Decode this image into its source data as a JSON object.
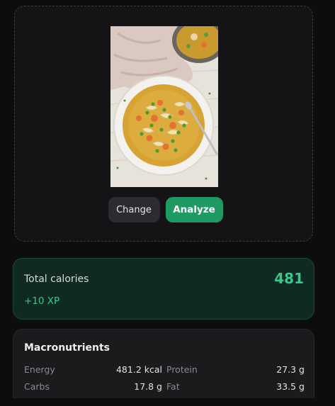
{
  "upload": {
    "change_label": "Change",
    "analyze_label": "Analyze"
  },
  "calories": {
    "label": "Total calories",
    "value": "481",
    "xp": "+10 XP"
  },
  "macros": {
    "title": "Macronutrients",
    "rows": [
      {
        "left_label": "Energy",
        "left_value": "481.2 kcal",
        "right_label": "Protein",
        "right_value": "27.3 g"
      },
      {
        "left_label": "Carbs",
        "left_value": "17.8 g",
        "right_label": "Fat",
        "right_value": "33.5 g"
      }
    ]
  },
  "colors": {
    "accent": "#1f9a63",
    "accent_text": "#36c98b",
    "background": "#0d0d0e"
  }
}
